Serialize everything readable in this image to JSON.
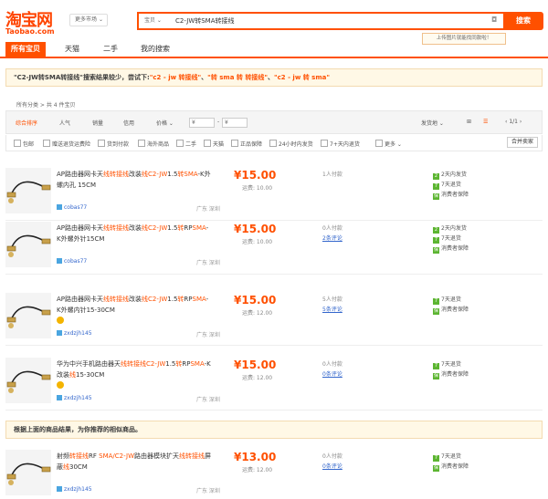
{
  "header": {
    "logo_cn": "淘宝网",
    "logo_en": "Taobao.com",
    "region": "更多市场",
    "search_category": "宝贝",
    "search_query": "C2-JW转SMA转接线",
    "search_button": "搜索",
    "image_search_tip": "上传图片就能找同款啦！"
  },
  "tabs": [
    "所有宝贝",
    "天猫",
    "二手",
    "我的搜索"
  ],
  "suggestion": {
    "prefix": "\"C2-JW转SMA转接线\"搜索结果较少，尝试下:",
    "links": [
      "\"c2 - jw 转接线\"",
      "\"转 sma 转 转接线\"",
      "\"c2 - jw 转 sma\""
    ],
    "sep": "、"
  },
  "breadcrumb": {
    "root": "所有分类",
    "count": "共 4 件宝贝"
  },
  "sort": {
    "items": [
      "综合排序",
      "人气",
      "销量",
      "信用",
      "价格"
    ],
    "price_from": "¥",
    "price_to": "¥",
    "ship_to": "发货地",
    "page": "1/1"
  },
  "filters": [
    "包邮",
    "赠送退货运费险",
    "货到付款",
    "海外商品",
    "二手",
    "天猫",
    "正品保障",
    "24小时内发货",
    "7+天内退货",
    "更多"
  ],
  "merge_button": "合并卖家",
  "products": [
    {
      "title_parts": [
        [
          "AP路由器网卡天",
          false
        ],
        [
          "线转接线",
          true
        ],
        [
          "改装",
          false
        ],
        [
          "线C2-JW",
          true
        ],
        [
          "1.5",
          false
        ],
        [
          "转",
          true
        ],
        [
          "SMA",
          true
        ],
        [
          "-K外螺内孔 15CM",
          false
        ]
      ],
      "price": "¥15.00",
      "shipping": "运费: 10.00",
      "sales": "1人付款",
      "reviews": "",
      "shop": "cobas77",
      "location": "广东 深圳",
      "gold": false,
      "services": [
        [
          "2天内发货",
          "2"
        ],
        [
          "7天退货",
          "7"
        ],
        [
          "消费者保障",
          "保"
        ]
      ]
    },
    {
      "title_parts": [
        [
          "AP路由器网卡天",
          false
        ],
        [
          "线转接线",
          true
        ],
        [
          "改装",
          false
        ],
        [
          "线C2-JW",
          true
        ],
        [
          "1.5",
          false
        ],
        [
          "转",
          true
        ],
        [
          "RP",
          false
        ],
        [
          "SMA",
          true
        ],
        [
          "-K外螺外针15CM",
          false
        ]
      ],
      "price": "¥15.00",
      "shipping": "运费: 10.00",
      "sales": "0人付款",
      "reviews": "2条评论",
      "shop": "cobas77",
      "location": "广东 深圳",
      "gold": false,
      "services": [
        [
          "2天内发货",
          "2"
        ],
        [
          "7天退货",
          "7"
        ],
        [
          "消费者保障",
          "保"
        ]
      ]
    },
    {
      "title_parts": [
        [
          "AP路由器网卡天",
          false
        ],
        [
          "线转接线",
          true
        ],
        [
          "改装",
          false
        ],
        [
          "线C2-JW",
          true
        ],
        [
          "1.5",
          false
        ],
        [
          "转",
          true
        ],
        [
          "RP",
          false
        ],
        [
          "SMA",
          true
        ],
        [
          "-K外螺内针15-30CM",
          false
        ]
      ],
      "price": "¥15.00",
      "shipping": "运费: 12.00",
      "sales": "5人付款",
      "reviews": "5条评论",
      "shop": "zxdzjh145",
      "location": "广东 深圳",
      "gold": true,
      "services": [
        [
          "7天退货",
          "7"
        ],
        [
          "消费者保障",
          "保"
        ]
      ]
    },
    {
      "title_parts": [
        [
          "华为中兴手机路由器天",
          false
        ],
        [
          "线转接线",
          true
        ],
        [
          "C2-JW",
          true
        ],
        [
          "1.5",
          false
        ],
        [
          "转",
          true
        ],
        [
          "RP",
          false
        ],
        [
          "SMA",
          true
        ],
        [
          "-K改装",
          false
        ],
        [
          "线",
          true
        ],
        [
          "15-30CM",
          false
        ]
      ],
      "price": "¥15.00",
      "shipping": "运费: 12.00",
      "sales": "0人付款",
      "reviews": "0条评论",
      "shop": "zxdzjh145",
      "location": "广东 深圳",
      "gold": true,
      "services": [
        [
          "7天退货",
          "7"
        ],
        [
          "消费者保障",
          "保"
        ]
      ]
    }
  ],
  "recommend_tip": "根据上面的商品结果，为你推荐的相似商品。",
  "recommended": [
    {
      "title_parts": [
        [
          "射频",
          false
        ],
        [
          "转接线",
          true
        ],
        [
          "RF ",
          false
        ],
        [
          "SMA/C2-JW",
          true
        ],
        [
          "路由器模块扩天",
          false
        ],
        [
          "线转",
          true
        ],
        [
          "接线",
          true
        ],
        [
          "屏蔽",
          false
        ],
        [
          "线",
          true
        ],
        [
          "30CM",
          false
        ]
      ],
      "price": "¥13.00",
      "shipping": "运费: 12.00",
      "sales": "0人付款",
      "reviews": "0条评论",
      "shop": "zxdzjh145",
      "location": "广东 深圳",
      "gold": false,
      "services": [
        [
          "7天退货",
          "7"
        ],
        [
          "消费者保障",
          "保"
        ]
      ]
    }
  ],
  "colors": {
    "accent": "#ff5000",
    "link": "#3366cc",
    "service_green": "#5cb531"
  }
}
